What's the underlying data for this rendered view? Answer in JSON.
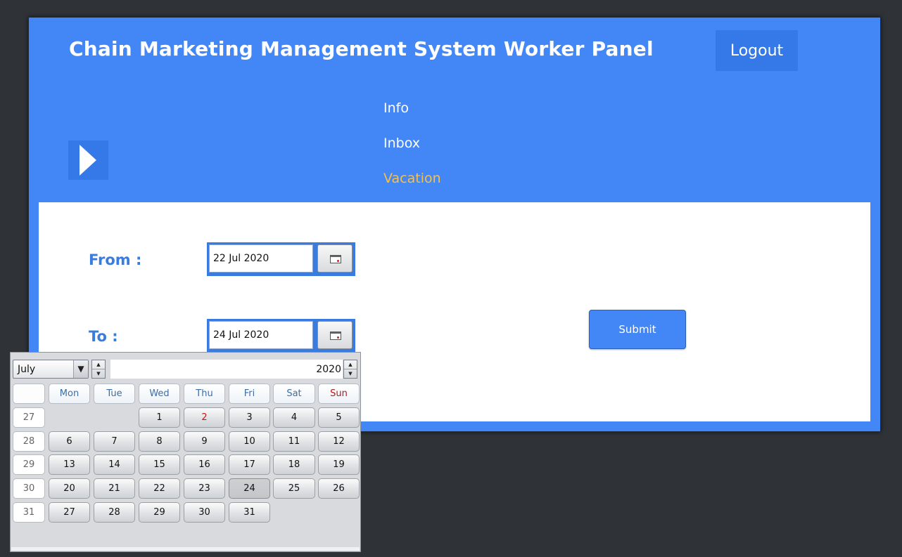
{
  "app": {
    "title": "Chain Marketing Management System Worker Panel",
    "logout_label": "Logout"
  },
  "nav": {
    "items": [
      {
        "label": "Info"
      },
      {
        "label": "Inbox"
      },
      {
        "label": "Vacation",
        "active": true
      }
    ]
  },
  "form": {
    "from_label": "From :",
    "from_value": "22 Jul 2020",
    "to_label": "To :",
    "to_value": "24 Jul 2020",
    "submit_label": "Submit"
  },
  "calendar": {
    "month": "July",
    "year": "2020",
    "weekday_headers": [
      "Mon",
      "Tue",
      "Wed",
      "Thu",
      "Fri",
      "Sat",
      "Sun"
    ],
    "weeks": [
      {
        "week": "27",
        "days": [
          "",
          "",
          "1",
          "2",
          "3",
          "4",
          "5"
        ]
      },
      {
        "week": "28",
        "days": [
          "6",
          "7",
          "8",
          "9",
          "10",
          "11",
          "12"
        ]
      },
      {
        "week": "29",
        "days": [
          "13",
          "14",
          "15",
          "16",
          "17",
          "18",
          "19"
        ]
      },
      {
        "week": "30",
        "days": [
          "20",
          "21",
          "22",
          "23",
          "24",
          "25",
          "26"
        ]
      },
      {
        "week": "31",
        "days": [
          "27",
          "28",
          "29",
          "30",
          "31",
          "",
          ""
        ]
      }
    ],
    "selected_day": "24",
    "highlighted_day": "2"
  },
  "colors": {
    "background": "#2f3337",
    "panel": "#4287f5",
    "accent_active": "#f5c04a",
    "label_blue": "#3a7be0"
  }
}
